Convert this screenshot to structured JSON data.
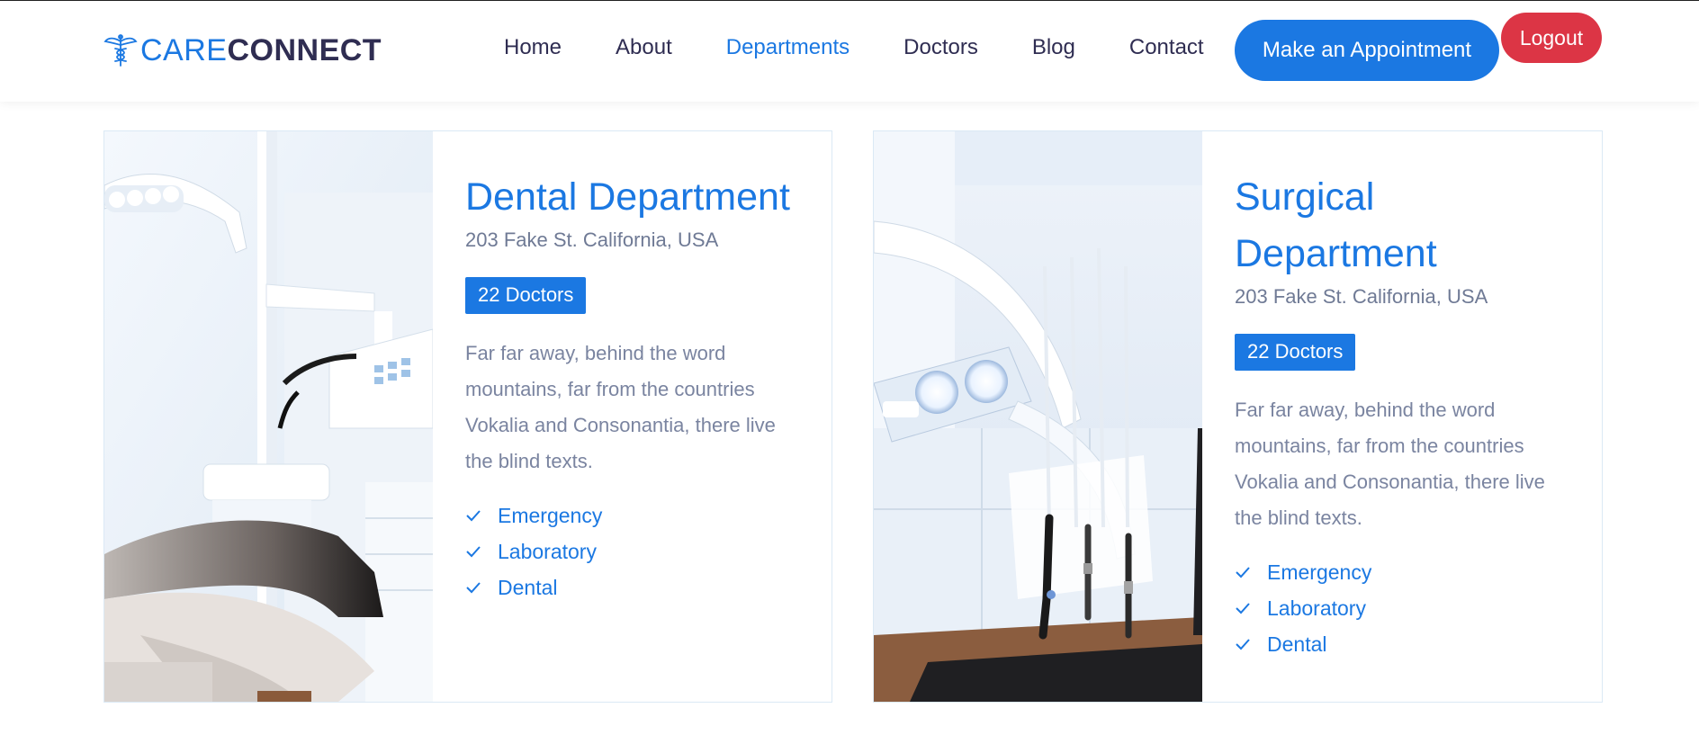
{
  "brand": {
    "part1": "CARE",
    "part2": "CONNECT"
  },
  "nav": {
    "items": [
      {
        "label": "Home",
        "active": false
      },
      {
        "label": "About",
        "active": false
      },
      {
        "label": "Departments",
        "active": true
      },
      {
        "label": "Doctors",
        "active": false
      },
      {
        "label": "Blog",
        "active": false
      },
      {
        "label": "Contact",
        "active": false
      }
    ],
    "appointment_label": "Make an Appointment",
    "logout_label": "Logout"
  },
  "departments": [
    {
      "title": "Dental Department",
      "address": "203 Fake St. California, USA",
      "doctors": "22 Doctors",
      "description": "Far far away, behind the word mountains, far from the countries Vokalia and Consonantia, there live the blind texts.",
      "features": [
        "Emergency",
        "Laboratory",
        "Dental"
      ]
    },
    {
      "title": "Surgical Department",
      "address": "203 Fake St. California, USA",
      "doctors": "22 Doctors",
      "description": "Far far away, behind the word mountains, far from the countries Vokalia and Consonantia, there live the blind texts.",
      "features": [
        "Emergency",
        "Laboratory",
        "Dental"
      ]
    }
  ],
  "colors": {
    "primary": "#1b78e2",
    "dark": "#2f2d52",
    "danger": "#dc3545",
    "muted": "#7a84a0"
  },
  "icons": {
    "logo": "caduceus-icon",
    "check": "check-icon"
  }
}
